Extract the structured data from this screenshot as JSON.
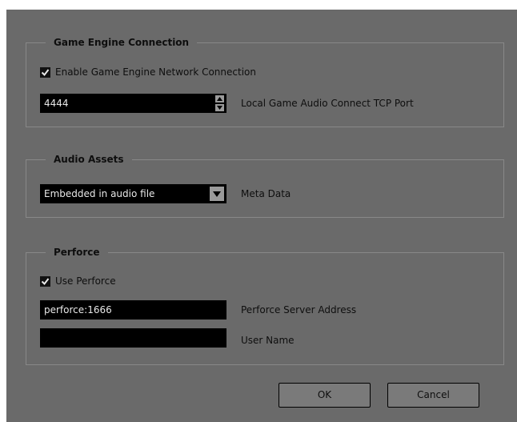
{
  "game_engine_connection": {
    "title": "Game Engine Connection",
    "enable_checkbox": {
      "label": "Enable Game Engine Network Connection",
      "checked": true
    },
    "port": {
      "value": "4444",
      "label": "Local Game Audio Connect TCP Port"
    }
  },
  "audio_assets": {
    "title": "Audio Assets",
    "meta_data": {
      "selected": "Embedded in audio file",
      "label": "Meta Data"
    }
  },
  "perforce": {
    "title": "Perforce",
    "use_checkbox": {
      "label": "Use Perforce",
      "checked": true
    },
    "server_address": {
      "value": "perforce:1666",
      "label": "Perforce Server Address"
    },
    "user_name": {
      "value": "",
      "label": "User Name"
    }
  },
  "buttons": {
    "ok": "OK",
    "cancel": "Cancel"
  },
  "colors": {
    "dialog_background": "#6a6a6a",
    "field_background": "#000000",
    "button_background": "#7a7a7a"
  },
  "icons": [
    "checkmark-icon",
    "spin-up-icon",
    "spin-down-icon",
    "dropdown-arrow-icon"
  ]
}
